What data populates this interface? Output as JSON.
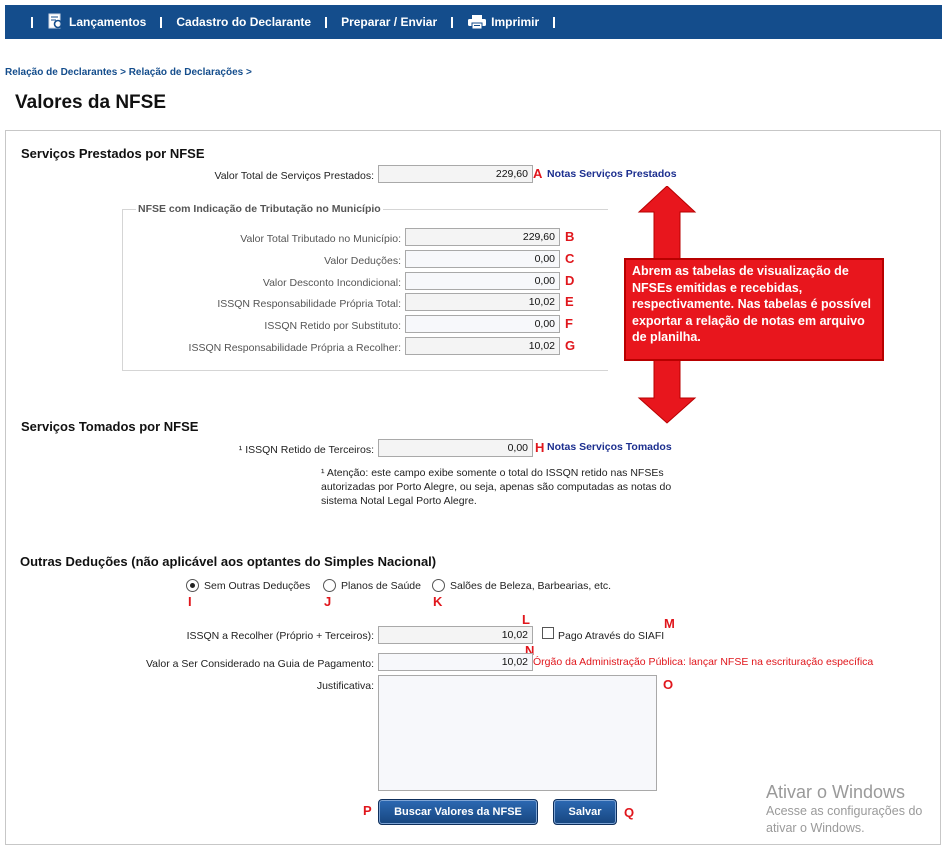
{
  "nav": {
    "lancamentos": "Lançamentos",
    "cadastro": "Cadastro do Declarante",
    "preparar": "Preparar / Enviar",
    "imprimir": "Imprimir"
  },
  "breadcrumb": {
    "item1": "Relação de Declarantes",
    "sep": ">",
    "item2": "Relação de Declarações"
  },
  "page": {
    "title": "Valores da NFSE"
  },
  "prestados": {
    "title": "Serviços Prestados por NFSE",
    "total_label": "Valor Total de Serviços Prestados:",
    "total_value": "229,60",
    "link": "Notas Serviços Prestados",
    "fieldset_legend": "NFSE com Indicação de Tributação no Município",
    "rows": [
      {
        "label": "Valor Total Tributado no Município:",
        "value": "229,60",
        "mark": "B"
      },
      {
        "label": "Valor Deduções:",
        "value": "0,00",
        "mark": "C"
      },
      {
        "label": "Valor Desconto Incondicional:",
        "value": "0,00",
        "mark": "D"
      },
      {
        "label": "ISSQN Responsabilidade Própria Total:",
        "value": "10,02",
        "mark": "E"
      },
      {
        "label": "ISSQN Retido por Substituto:",
        "value": "0,00",
        "mark": "F"
      },
      {
        "label": "ISSQN Responsabilidade Própria a Recolher:",
        "value": "10,02",
        "mark": "G"
      }
    ]
  },
  "tomados": {
    "title": "Serviços Tomados por NFSE",
    "retido_label": "¹ ISSQN Retido de Terceiros:",
    "retido_value": "0,00",
    "link": "Notas Serviços Tomados",
    "note_line1": "¹ Atenção: este campo exibe somente o total do ISSQN retido nas NFSEs",
    "note_line2": "autorizadas por Porto Alegre, ou seja, apenas são computadas as notas do",
    "note_line3": "sistema Notal Legal Porto Alegre."
  },
  "outras": {
    "title": "Outras Deduções (não aplicável aos optantes do Simples Nacional)",
    "options": [
      "Sem Outras Deduções",
      "Planos de Saúde",
      "Salões de Beleza, Barbearias, etc."
    ],
    "issqn_label": "ISSQN a Recolher (Próprio + Terceiros):",
    "issqn_value": "10,02",
    "siafi_label": "Pago Através do SIAFI",
    "guia_label": "Valor a Ser Considerado na Guia de Pagamento:",
    "guia_value": "10,02",
    "orgao_note": "Órgão da Administração Pública: lançar NFSE na escrituração específica",
    "justificativa_label": "Justificativa:",
    "justificativa_value": ""
  },
  "buttons": {
    "buscar": "Buscar Valores da NFSE",
    "salvar": "Salvar"
  },
  "marks": {
    "a": "A",
    "h": "H",
    "i": "I",
    "j": "J",
    "k": "K",
    "l": "L",
    "m": "M",
    "n": "N",
    "o": "O",
    "p": "P",
    "q": "Q"
  },
  "callout": {
    "text": "Abrem as tabelas de visualização de NFSEs emitidas e recebidas, respectivamente. Nas tabelas é possível exportar a relação de notas em arquivo de planilha."
  },
  "watermark": {
    "line1": "Ativar o Windows",
    "line2": "Acesse as configurações do",
    "line3": "ativar o Windows."
  },
  "colors": {
    "nav_bg": "#144d8c",
    "mark_red": "#e0161c",
    "link_blue": "#1c2f8f",
    "callout_red": "#e8161d"
  },
  "icons": {
    "lancamentos": "document-search-icon",
    "imprimir": "printer-icon"
  }
}
